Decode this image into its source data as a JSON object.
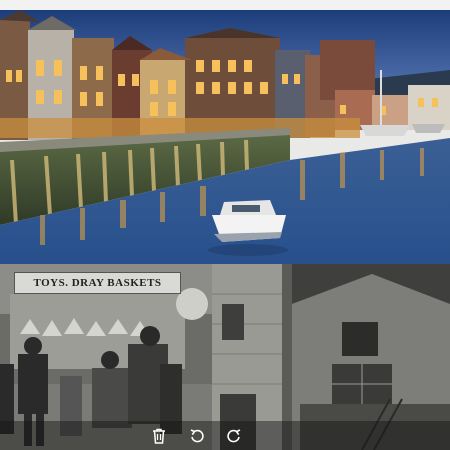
{
  "photos": {
    "shop_sign_text": "TOYS.  DRAY  BASKETS"
  },
  "toolbar": {
    "buttons": [
      {
        "icon": "trash-icon"
      },
      {
        "icon": "rotate-left-icon"
      },
      {
        "icon": "rotate-right-icon"
      }
    ]
  },
  "colors": {
    "sky_top": "#1c3d7a",
    "sky_bottom": "#5d7fc0",
    "water": "#2a4f86",
    "harbour_lights": "#f6b54a",
    "boat": "#f3f3f3",
    "toolbar_overlay": "#141414"
  }
}
